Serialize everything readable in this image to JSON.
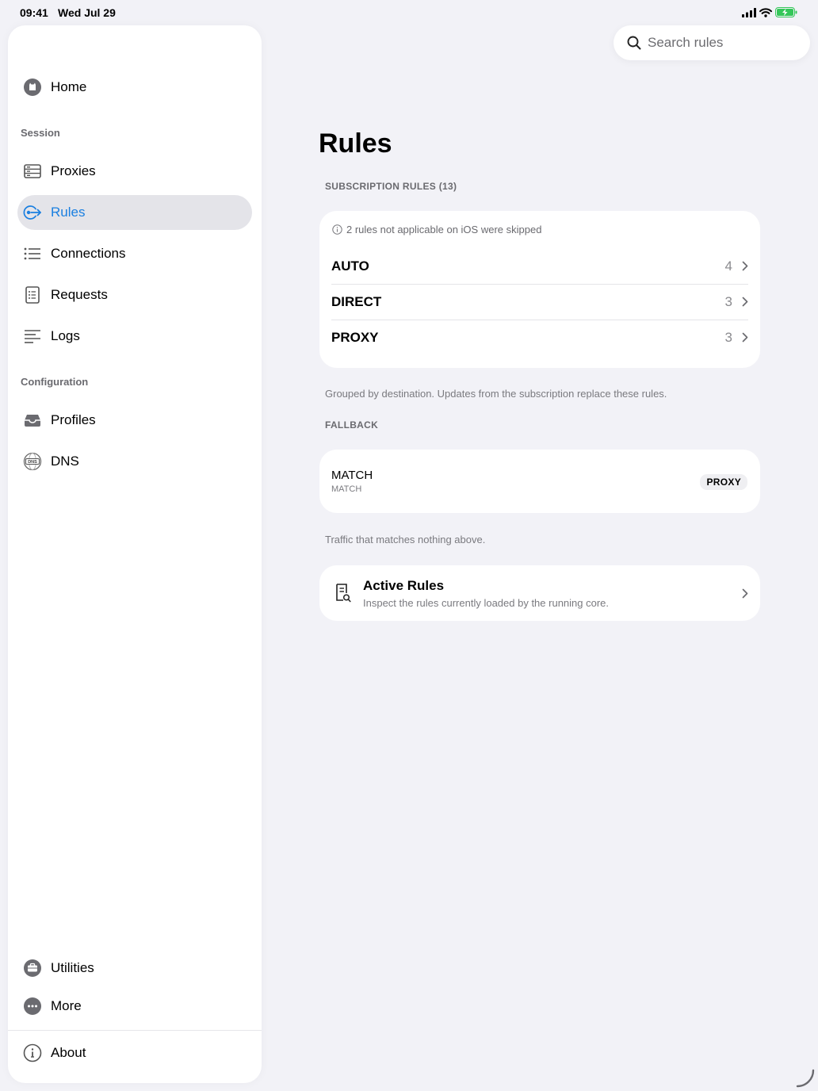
{
  "status_bar": {
    "time": "09:41",
    "date": "Wed Jul 29"
  },
  "sidebar": {
    "home": "Home",
    "section_session": "Session",
    "proxies": "Proxies",
    "rules": "Rules",
    "connections": "Connections",
    "requests": "Requests",
    "logs": "Logs",
    "section_configuration": "Configuration",
    "profiles": "Profiles",
    "dns": "DNS",
    "utilities": "Utilities",
    "more": "More",
    "about": "About",
    "selected": "rules"
  },
  "search": {
    "placeholder": "Search rules"
  },
  "main": {
    "title": "Rules",
    "subscription_header": "SUBSCRIPTION RULES (13)",
    "skipped_notice": "2 rules not applicable on iOS were skipped",
    "groups": [
      {
        "name": "AUTO",
        "count": "4"
      },
      {
        "name": "DIRECT",
        "count": "3"
      },
      {
        "name": "PROXY",
        "count": "3"
      }
    ],
    "groups_footer": "Grouped by destination. Updates from the subscription replace these rules.",
    "fallback_header": "FALLBACK",
    "fallback": {
      "title": "MATCH",
      "subtitle": "MATCH",
      "policy": "PROXY"
    },
    "fallback_footer": "Traffic that matches nothing above.",
    "active_rules": {
      "title": "Active Rules",
      "subtitle": "Inspect the rules currently loaded by the running core."
    }
  },
  "colors": {
    "accent": "#1a7fe0",
    "background": "#f2f2f7",
    "card": "#ffffff",
    "battery": "#34c759"
  }
}
